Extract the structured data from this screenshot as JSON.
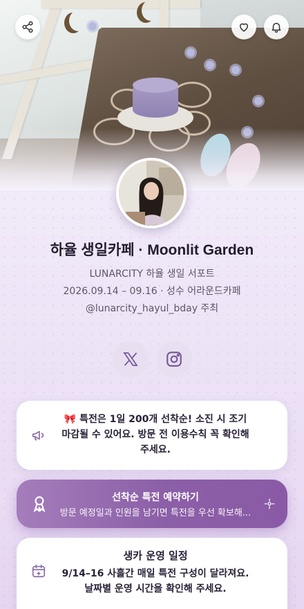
{
  "header": {
    "share_icon": "share-icon",
    "like_icon": "heart-icon",
    "notify_icon": "bell-icon"
  },
  "profile": {
    "title": "하율 생일카페 · Moonlit Garden",
    "organizer_line": "LUNARCITY 하율 생일 서포트",
    "date_place": "2026.09.14 – 09.16 · 성수 어라운드카페",
    "host": "@lunarcity_hayul_bday 주최"
  },
  "social": {
    "x_icon": "x-logo-icon",
    "instagram_icon": "instagram-icon"
  },
  "notice": {
    "icon": "megaphone-icon",
    "text": "🎀 특전은 1일 200개 선착순! 소진 시 조기 마감될 수 있어요. 방문 전 이용수칙 꼭 확인해 주세요."
  },
  "cta": {
    "icon": "ribbon-icon",
    "title": "선착순 특전 예약하기",
    "subtitle": "방문 예정일과 인원을 남기면 특전을 우선 확보해...",
    "trailing_icon": "sparkle-icon"
  },
  "schedule": {
    "icon": "calendar-icon",
    "title": "생카 운영 일정",
    "text": "9/14–16 사흘간 매일 특전 구성이 달라져요. 날짜별 운영 시간을 확인해 주세요."
  },
  "colors": {
    "accent": "#8b5fa7",
    "icon_tint": "#7a5a9a",
    "background": "#f3edf9"
  }
}
